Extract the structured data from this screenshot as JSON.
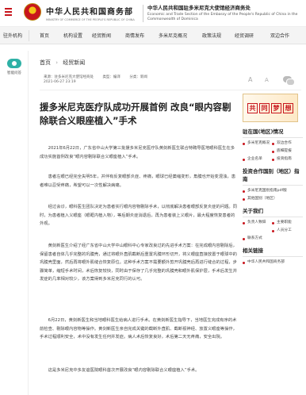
{
  "header": {
    "site_name_cn": "中华人民共和国商务部",
    "site_name_en": "MINISTRY OF COMMERCE OF THE PEOPLE'S REPUBLIC OF CHINA",
    "embassy_cn": "中华人民共和国驻多米尼克大使馆经济商务处",
    "embassy_en": "Economic and Trade Section of the Embassy of the People's Republic of China in the Commonwealth of Dominica"
  },
  "nav": {
    "items": [
      "驻外机构",
      "首页",
      "机构设置",
      "经贸新闻",
      "商情发布",
      "多米尼克概况",
      "政策法规",
      "经贸调研",
      "双边合作"
    ]
  },
  "left_rail": {
    "label": "智能问答"
  },
  "breadcrumb": {
    "home": "首页",
    "separator": "›",
    "section": "经贸新闻"
  },
  "article": {
    "source": "来源：驻多米尼克大使馆经商处",
    "type": "类型：编译",
    "category": "分类：新闻",
    "date": "2021-06-27 23:19",
    "title": "援多米尼克医疗队成功开展首例 改良“眼内容剔除联合义眼座植入”手术",
    "paragraphs": [
      "2021年6月22日，广东省中山大学第三批援多米尼克医疗队黄剑新医生联合特聘导医地眼科医生在多成功实施首例改良“眼内容剔除联合义眼座植入”手术。",
      "患者左眼已经完全失明5年，并伴有反复眼部炎症、疼痛，眼球已经萎缩变形，角膜也开始变混浊，患者难以忍受疼痛，希望可以一次性解决病痛。",
      "经过会诊，眼科医生团队决定为患者实行眼内容物剔除手术，以彻底解决患者眼部反复炎症的问题。同时，为患者植入义眼座（眼眶内植入物），等后期炎症消退后，再为患者装上义眼片，最大程度恢复患者的外观。",
      "黄剑新医生介绍了经广东省中山大学中山眼科中心专家改良过的先进手术方案：在完成眼内容剔除后，保留患者自体几乎完整的巩膜壳，通过将眼外直肌截断后重置巩膜环形切开，将义眼座直接放置于眼球中的巩膜壳里面，然后再将眼外肌缝合恢复原位。这种手术方案不需要额外剪开巩膜壳后再进行缝合的过程，步骤简单，缩短手术时间，术后恢复较快，同时由于保存了几乎完整的巩膜壳和眼外肌保护层，手术后发生并发症的几率相对较少，该方案得到多米尼克同行的认可。",
      "6月22日，黄剑新医生和当地眼科医生给病人进行手术。在黄剑新医生指导下，当地医生完成有序的术前检查、剔除眼内容物等操作。黄剑新医生亲自完成关键的截断外直肌、截断视神经、放置义眼座等操作，手术过程顺利安全，术中没有发生任何并发症。病人术后恢复良好，术后第二天无疼痛，安全出院。",
      "这是多米尼克中多友谊医院眼科首次开展改良“眼内容剔除联合义眼座植入”手术。"
    ]
  },
  "toolbar": {
    "font_large": "A",
    "font_small": "A",
    "share_icon": "wechat-icon"
  },
  "sidebar": {
    "banner_chars": [
      "共",
      "同",
      "梦",
      "想"
    ],
    "sections": [
      {
        "heading": "驻在国(地区)情况",
        "rows": [
          [
            "多米尼克概况",
            "双边合作"
          ],
          [
            "",
            "底细提报"
          ],
          [
            "企业名单",
            "投资指南"
          ]
        ]
      },
      {
        "heading": "投资合作国别（地区）指南",
        "rows": [
          [
            "多米尼克国别指南pdf版"
          ],
          [
            "其他国别（地区）"
          ]
        ]
      },
      {
        "heading": "关于我们",
        "rows": [
          [
            "负责人致辞",
            "主要职能"
          ],
          [
            "",
            "人员分工"
          ],
          [
            "联系方式"
          ]
        ]
      },
      {
        "heading": "相关链接",
        "rows": [
          [
            "中华人民共和国商务部"
          ]
        ]
      }
    ]
  },
  "colors": {
    "brand_red": "#c8161d",
    "rail_accent": "#2fb1a6"
  }
}
